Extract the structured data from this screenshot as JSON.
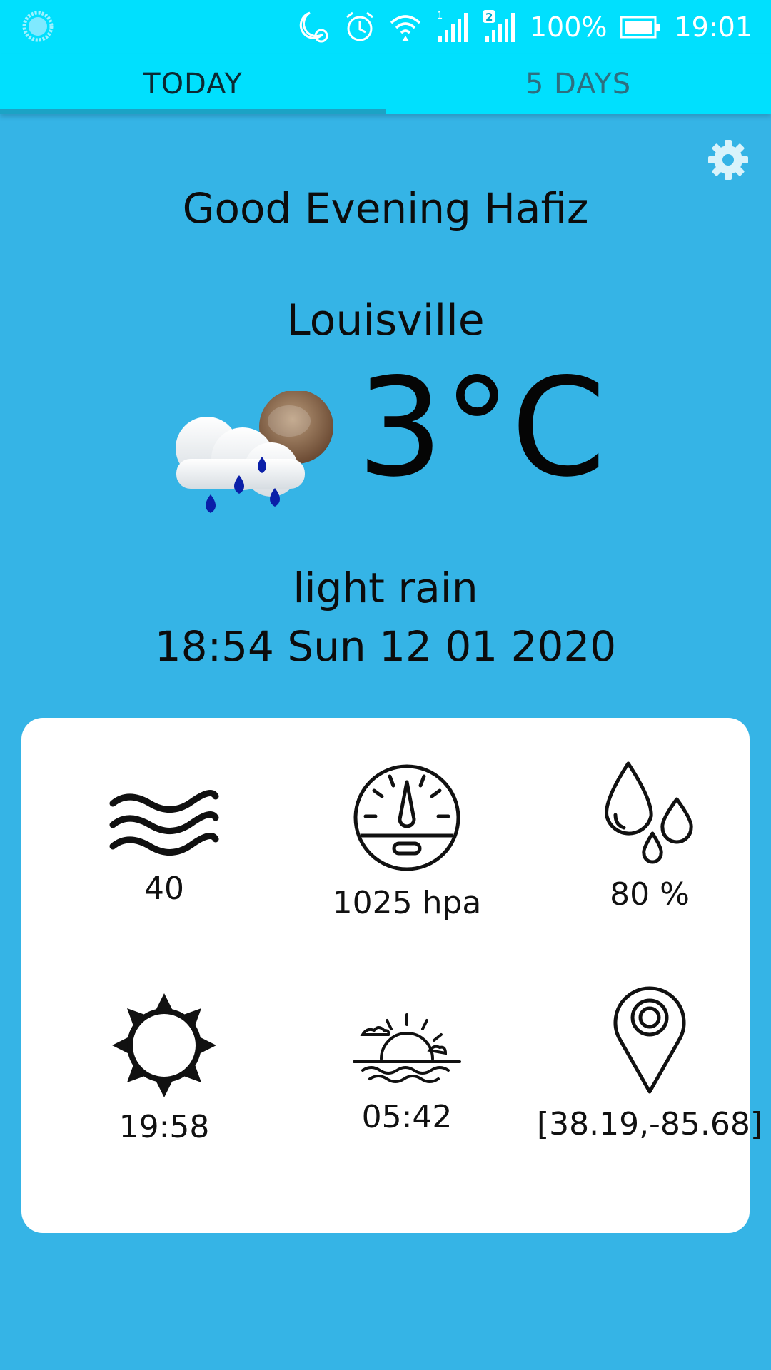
{
  "status_bar": {
    "battery": "100%",
    "time": "19:01",
    "sim_badge": "2",
    "sim1_label": "1"
  },
  "tabs": [
    {
      "label": "TODAY"
    },
    {
      "label": "5 DAYS"
    }
  ],
  "greeting": "Good Evening Hafiz",
  "city": "Louisville",
  "temperature": "3°C",
  "condition": "light rain",
  "datetime": "18:54 Sun 12 01 2020",
  "details": {
    "wind": "40",
    "pressure": "1025 hpa",
    "humidity": "80 %",
    "sunset": "19:58",
    "sunrise": "05:42",
    "coordinates": "[38.19,-85.68]"
  },
  "icons": {
    "weather": "rain-cloud-moon-icon",
    "settings": "gear-icon",
    "wind": "wind-icon",
    "pressure": "barometer-icon",
    "humidity": "drops-icon",
    "sunset": "sun-icon",
    "sunrise": "sunrise-icon",
    "location": "location-pin-icon"
  },
  "colors": {
    "background": "#35b4e6",
    "tabbar": "#00e0fe",
    "card": "#ffffff"
  }
}
